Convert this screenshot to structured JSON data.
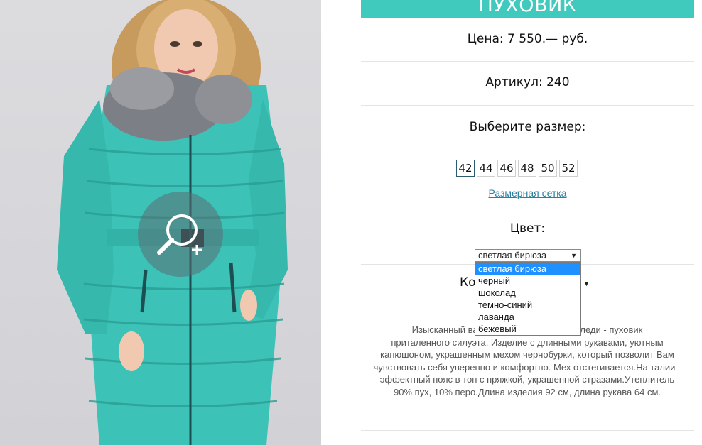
{
  "product": {
    "title": "ПУХОВИК",
    "price": "Цена: 7 550.— руб.",
    "article": "Артикул: 240",
    "size_prompt": "Выберите размер:",
    "sizes": [
      "42",
      "44",
      "46",
      "48",
      "50",
      "52"
    ],
    "selected_size": "42",
    "size_chart_link": "Размерная сетка",
    "color_label": "Цвет:",
    "color_selected": "светлая бирюза",
    "color_options": [
      "светлая бирюза",
      "черный",
      "шоколад",
      "темно-синий",
      "лаванда",
      "бежевый"
    ],
    "qty_label": "Ко",
    "description_visible": "Изысканный вари… их леди - пуховик приталенного силуэта. Изделие с длинными рукавами, уютным капюшоном, украшенным мехом чернобурки, который позволит Вам чувствовать себя уверенно и комфортно. Мех отстегивается.На талии - эффектный пояс в тон с пряжкой, украшенной стразами.Утеплитель 90% пух, 10% перо.Длина изделия 92 см, длина рукава 64 см."
  },
  "description_lines": [
    "Изысканный вари                               их леди - пуховик",
    "приталенного силуэта. Изделие с длинными рукавами, уютным",
    "капюшоном, украшенным мехом чернобурки, который позволит Вам",
    "чувствовать себя уверенно и комфортно. Мех отстегивается.На талии -",
    "эффектный пояс в тон с пряжкой, украшенной стразами.Утеплитель",
    "90% пух, 10% перо.Длина изделия 92 см, длина рукава 64 см."
  ],
  "colors": {
    "accent": "#40c9bd",
    "link": "#2a7fa3",
    "dropdown_highlight": "#1e90ff",
    "coat": "#3cc2b6"
  },
  "icons": {
    "zoom": "zoom-in-icon",
    "dropdown_arrow": "triangle-down-icon"
  }
}
